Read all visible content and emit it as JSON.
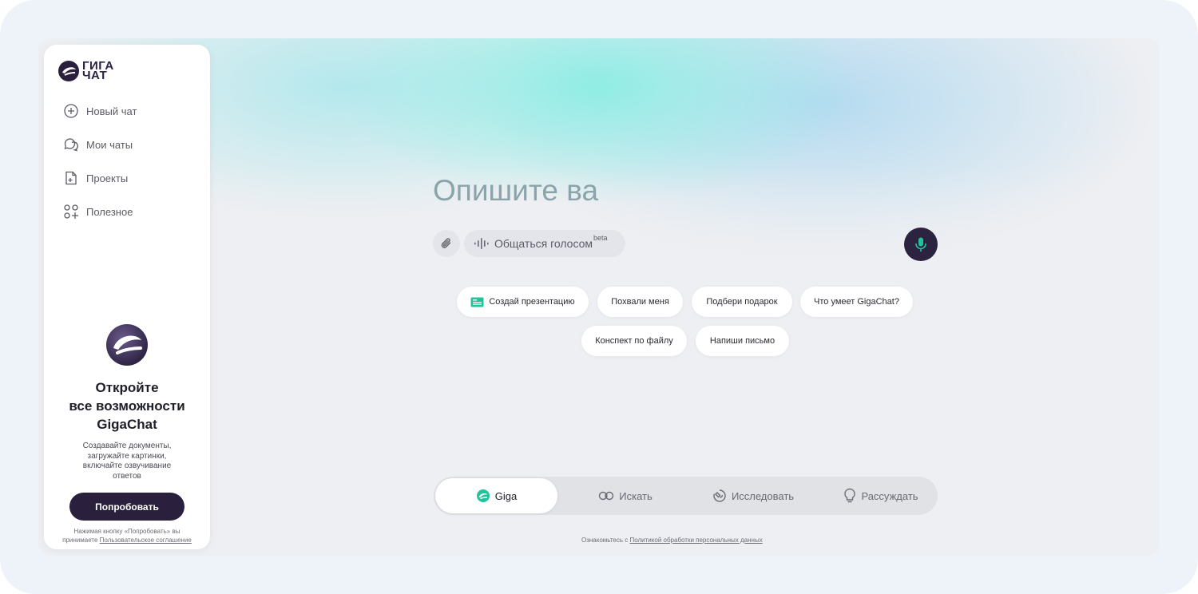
{
  "brand": {
    "logo_line1": "ГИГА",
    "logo_line2": "ЧАТ"
  },
  "sidebar": {
    "items": [
      {
        "label": "Новый чат",
        "icon": "plus-circle-icon"
      },
      {
        "label": "Мои чаты",
        "icon": "chat-bubbles-icon"
      },
      {
        "label": "Проекты",
        "icon": "project-doc-icon"
      },
      {
        "label": "Полезное",
        "icon": "apps-plus-icon"
      }
    ]
  },
  "promo": {
    "title_line1": "Откройте",
    "title_line2": "все возможности",
    "title_line3": "GigaChat",
    "desc_line1": "Создавайте документы,",
    "desc_line2": "загружайте картинки,",
    "desc_line3": "включайте озвучивание",
    "desc_line4": "ответов",
    "button_label": "Попробовать",
    "legal_line1": "Нажимая кнопку «Попробовать» вы",
    "legal_prefix": "принимаете ",
    "legal_link": "Пользовательское соглашение"
  },
  "composer": {
    "prompt_text": "Опишите ва",
    "voice_label": "Общаться голосом",
    "voice_badge": "beta"
  },
  "suggestions": [
    "Создай презентацию",
    "Похвали меня",
    "Подбери подарок",
    "Что умеет GigaChat?",
    "Конспект по файлу",
    "Напиши письмо"
  ],
  "modes": [
    {
      "label": "Giga",
      "active": true
    },
    {
      "label": "Искать",
      "active": false
    },
    {
      "label": "Исследовать",
      "active": false
    },
    {
      "label": "Рассуждать",
      "active": false
    }
  ],
  "footer": {
    "prefix": "Ознакомьтесь с ",
    "link": "Политикой обработки персональных данных"
  },
  "colors": {
    "brand_dark": "#2a1f3d",
    "accent_green": "#21c39b",
    "prompt_text": "#8aa4aa"
  }
}
